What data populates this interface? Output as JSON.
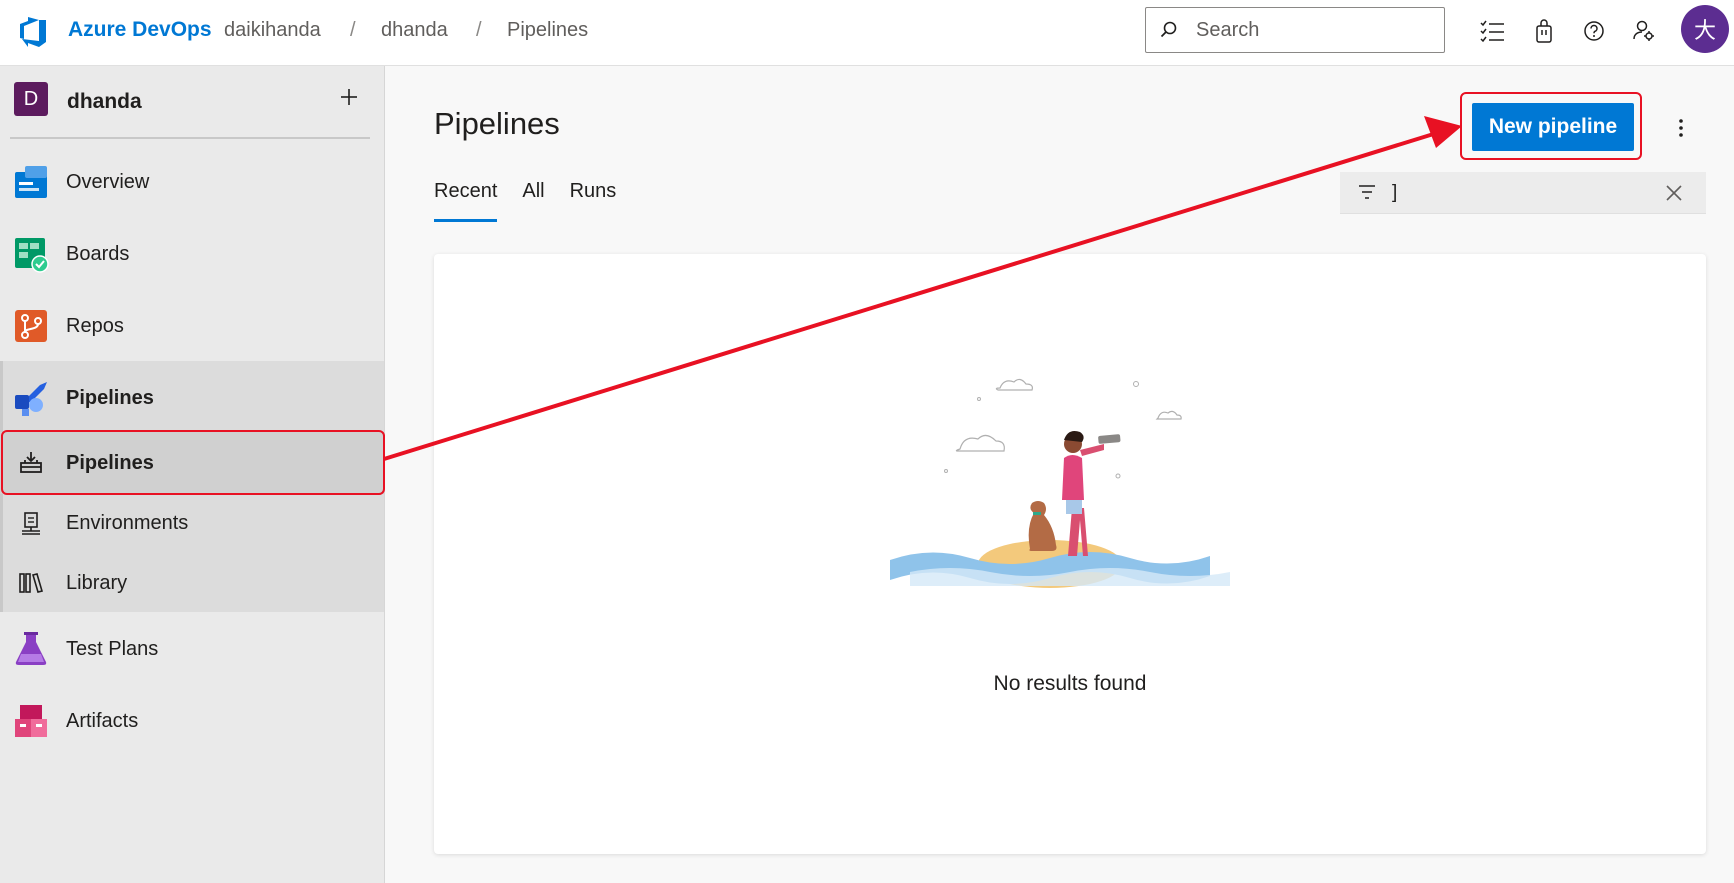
{
  "header": {
    "brand": "Azure DevOps",
    "breadcrumbs": [
      "daikihanda",
      "dhanda",
      "Pipelines"
    ],
    "search_placeholder": "Search",
    "avatar_initial": "大"
  },
  "sidebar": {
    "project_initial": "D",
    "project_name": "dhanda",
    "items": [
      {
        "label": "Overview",
        "icon": "overview-icon"
      },
      {
        "label": "Boards",
        "icon": "boards-icon"
      },
      {
        "label": "Repos",
        "icon": "repos-icon"
      },
      {
        "label": "Pipelines",
        "icon": "pipelines-icon"
      },
      {
        "label": "Pipelines",
        "icon": "pipelines-sub-icon"
      },
      {
        "label": "Environments",
        "icon": "environments-icon"
      },
      {
        "label": "Library",
        "icon": "library-icon"
      },
      {
        "label": "Test Plans",
        "icon": "test-plans-icon"
      },
      {
        "label": "Artifacts",
        "icon": "artifacts-icon"
      }
    ]
  },
  "main": {
    "title": "Pipelines",
    "tabs": [
      {
        "label": "Recent",
        "active": true
      },
      {
        "label": "All",
        "active": false
      },
      {
        "label": "Runs",
        "active": false
      }
    ],
    "new_pipeline_label": "New pipeline",
    "filter_value": "]",
    "empty_message": "No results found"
  },
  "colors": {
    "accent": "#0078d4",
    "annotation": "#e81123",
    "avatar": "#5c2d91",
    "project_avatar": "#5c1b5e"
  }
}
